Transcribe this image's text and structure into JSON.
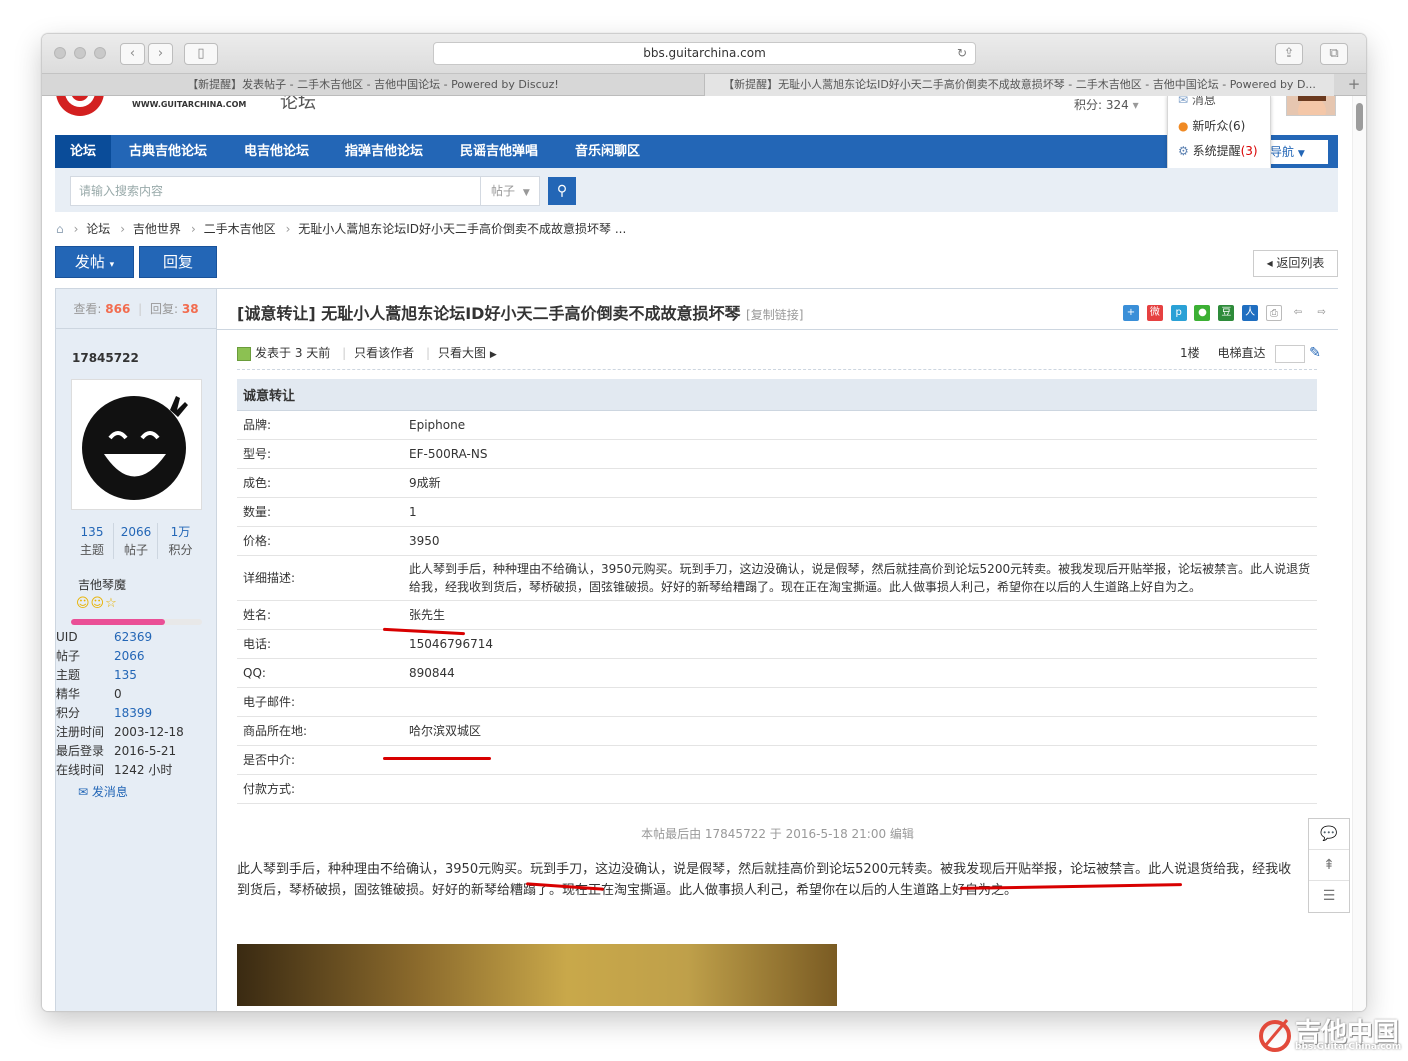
{
  "browser": {
    "url": "bbs.guitarchina.com",
    "tabs": [
      {
        "label": "【新提醒】发表帖子 - 二手木吉他区 - 吉他中国论坛 - Powered by Discuz!"
      },
      {
        "label": "【新提醒】无耻小人蒿旭东论坛ID好小天二手高价倒卖不成故意损坏琴 - 二手木吉他区 - 吉他中国论坛 - Powered by D..."
      }
    ],
    "new_tab": "+"
  },
  "header": {
    "logo_text": "WWW.GUITARCHINA.COM",
    "logo_sub": "论坛",
    "score": "积分: 324",
    "popup": {
      "message": "消息",
      "listeners": "新听众(6)",
      "system_label": "系统提醒",
      "system_count": "(3)"
    },
    "nav_more": "导航"
  },
  "nav": {
    "items": [
      {
        "label": "论坛"
      },
      {
        "label": "古典吉他论坛"
      },
      {
        "label": "电吉他论坛"
      },
      {
        "label": "指弹吉他论坛"
      },
      {
        "label": "民谣吉他弹唱"
      },
      {
        "label": "音乐闲聊区"
      }
    ]
  },
  "search": {
    "placeholder": "请输入搜索内容",
    "type": "帖子"
  },
  "breadcrumb": {
    "items": [
      "论坛",
      "吉他世界",
      "二手木吉他区",
      "无耻小人蒿旭东论坛ID好小天二手高价倒卖不成故意损坏琴 ..."
    ]
  },
  "actions": {
    "post": "发帖",
    "reply": "回复",
    "back": "返回列表"
  },
  "thread": {
    "views_label": "查看:",
    "views": "866",
    "replies_label": "回复:",
    "replies": "38",
    "tag": "[诚意转让]",
    "title": "无耻小人蒿旭东论坛ID好小天二手高价倒卖不成故意损坏琴",
    "copy_link": "[复制链接]"
  },
  "author": {
    "name": "17845722",
    "stats": [
      {
        "value": "135",
        "label": "主题"
      },
      {
        "value": "2066",
        "label": "帖子"
      },
      {
        "value": "1万",
        "label": "积分"
      }
    ],
    "group": "吉他琴魔",
    "level_progress": 0.72,
    "profile": [
      {
        "key": "UID",
        "value": "62369"
      },
      {
        "key": "帖子",
        "value": "2066"
      },
      {
        "key": "主题",
        "value": "135"
      },
      {
        "key": "精华",
        "value": "0"
      },
      {
        "key": "积分",
        "value": "18399"
      },
      {
        "key": "注册时间",
        "value": "2003-12-18"
      },
      {
        "key": "最后登录",
        "value": "2016-5-21"
      },
      {
        "key": "在线时间",
        "value": "1242 小时"
      }
    ],
    "send_message": "发消息"
  },
  "post": {
    "posted": "发表于 3 天前",
    "only_author": "只看该作者",
    "big_image": "只看大图",
    "floor": "1楼",
    "jump_label": "电梯直达",
    "form_title": "诚意转让",
    "fields": [
      {
        "key": "品牌:",
        "value": "Epiphone"
      },
      {
        "key": "型号:",
        "value": "EF-500RA-NS"
      },
      {
        "key": "成色:",
        "value": "9成新"
      },
      {
        "key": "数量:",
        "value": "1"
      },
      {
        "key": "价格:",
        "value": "3950"
      },
      {
        "key": "详细描述:",
        "value": "此人琴到手后，种种理由不给确认，3950元购买。玩到手刀，这边没确认，说是假琴，然后就挂高价到论坛5200元转卖。被我发现后开贴举报，论坛被禁言。此人说退货给我，经我收到货后，琴桥破损，固弦锥破损。好好的新琴给糟蹋了。现在正在淘宝撕逼。此人做事损人利己，希望你在以后的人生道路上好自为之。"
      },
      {
        "key": "姓名:",
        "value": "张先生"
      },
      {
        "key": "电话:",
        "value": "15046796714"
      },
      {
        "key": "QQ:",
        "value": "890844"
      },
      {
        "key": "电子邮件:",
        "value": ""
      },
      {
        "key": "商品所在地:",
        "value": "哈尔滨双城区"
      },
      {
        "key": "是否中介:",
        "value": ""
      },
      {
        "key": "付款方式:",
        "value": ""
      }
    ],
    "edit_note": "本帖最后由 17845722 于 2016-5-18 21:00 编辑",
    "body": "此人琴到手后，种种理由不给确认，3950元购买。玩到手刀，这边没确认，说是假琴，然后就挂高价到论坛5200元转卖。被我发现后开贴举报，论坛被禁言。此人说退货给我，经我收到货后，琴桥破损，固弦锥破损。好好的新琴给糟蹋了。现在正在淘宝撕逼。此人做事损人利己，希望你在以后的人生道路上好自为之。"
  },
  "share_icons": [
    "qzone-icon",
    "weibo-icon",
    "tencent-weibo-icon",
    "wechat-icon",
    "douban-icon",
    "renren-icon",
    "print-icon",
    "prev-icon",
    "next-icon"
  ],
  "watermark": {
    "title": "吉他中国",
    "url": "bbs.GuitarChina.com"
  },
  "colors": {
    "nav": "#2366b6",
    "accent_red": "#d80000",
    "count_orange": "#f26c4f"
  }
}
